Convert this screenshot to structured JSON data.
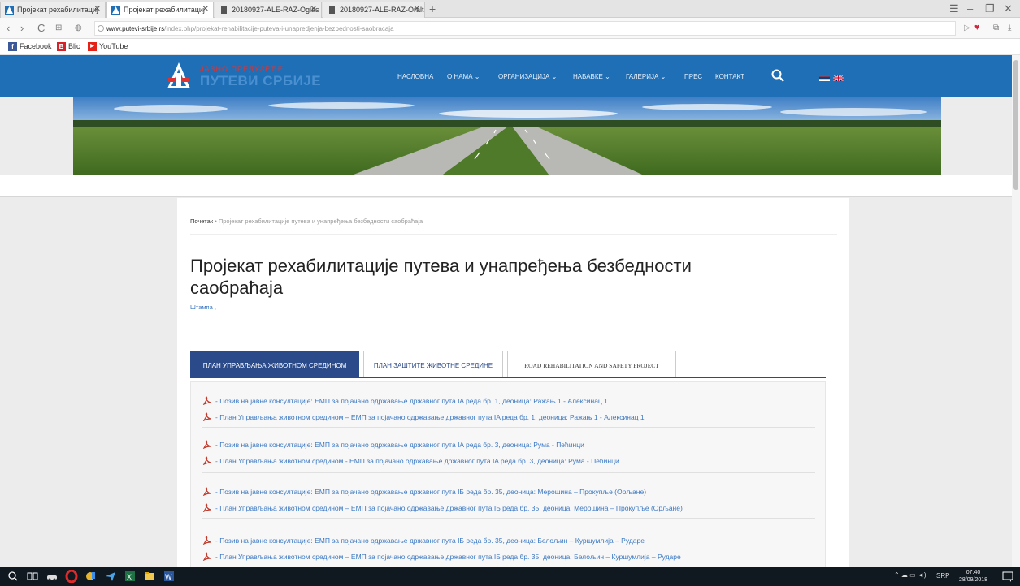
{
  "browser": {
    "tabs": [
      {
        "label": "Пројекат рехабилитациј",
        "active": false
      },
      {
        "label": "Пројекат рехабилитациј",
        "active": true
      },
      {
        "label": "20180927-ALE-RAZ-Oglas",
        "active": false
      },
      {
        "label": "20180927-ALE-RAZ-Oralt",
        "active": false
      }
    ],
    "new_tab": "+",
    "url_host": "www.putevi-srbije.rs",
    "url_path": "/index.php/projekat-rehabilitacije-puteva-i-unapredjenja-bezbednosti-saobracaja",
    "bookmarks": [
      {
        "label": "Facebook",
        "color": "#3b5998",
        "glyph": "f"
      },
      {
        "label": "Blic",
        "color": "#d6232a",
        "glyph": "B"
      },
      {
        "label": "YouTube",
        "color": "#e62117",
        "glyph": "▶"
      }
    ]
  },
  "site": {
    "logo_top": "ЈАВНО ПРЕДУЗЕЋЕ",
    "logo_main": "ПУТЕВИ СРБИЈЕ",
    "menu": [
      "НАСЛОВНА",
      "О НАМА",
      "ОРГАНИЗАЦИЈА",
      "НАБАВКЕ",
      "ГАЛЕРИЈА",
      "ПРЕС",
      "КОНТАКТ"
    ],
    "menu_has_dropdown": [
      false,
      true,
      true,
      true,
      true,
      false,
      false
    ],
    "header_color": "#1f6fb7"
  },
  "content": {
    "breadcrumb_home": "Почетак",
    "breadcrumb_sep": "•",
    "breadcrumb_current": "Пројекат рехабилитације путева и унапређења безбедности саобраћаја",
    "title": "Пројекат рехабилитације путева и унапређења безбедности саобраћаја",
    "print_link": "Штампа ,",
    "tabs": [
      {
        "label": "ПЛАН УПРАВЉАЊА ЖИВОТНОМ СРЕДИНОМ",
        "active": true
      },
      {
        "label": "ПЛАН ЗАШТИТЕ ЖИВОТНЕ СРЕДИНЕ",
        "active": false
      },
      {
        "label": "ROAD REHABILITATION AND SAFETY PROJECT",
        "active": false
      }
    ],
    "doc_groups": [
      [
        "- Позив на јавне консултације: ЕМП за појачано одржавање државног пута IA реда бр. 1, деоница: Ражањ 1 - Алексинац 1",
        "- План Управљања животном средином – ЕМП за појачано одржавање државног пута IA реда бр. 1, деоница: Ражањ 1 - Алексинац 1"
      ],
      [
        "- Позив на јавне консултације: ЕМП за појачано одржавање државног пута IA реда бр. 3, деоница: Рума - Пећинци",
        "- План Управљања животном средином - ЕМП за појачано одржавање државног пута IA реда бр. 3, деоница: Рума - Пећинци"
      ],
      [
        "- Позив на јавне консултације: ЕМП за појачано одржавање државног пута IБ реда бр. 35, деоница: Мерошина – Прокупље (Орљане)",
        "- План Управљања животном средином – ЕМП за појачано одржавање државног пута IБ реда бр. 35, деоница: Мерошина – Прокупље (Орљане)"
      ],
      [
        "- Позив на јавне консултације: ЕМП за појачано одржавање државног пута IБ реда бр. 35, деоница: Белољин – Куршумлија – Рударе",
        "- План Управљања животном средином – ЕМП за појачано одржавање државног пута IБ реда бр. 35, деоница: Белољин – Куршумлија – Рударе"
      ]
    ]
  },
  "taskbar": {
    "lang": "SRP",
    "time": "07:40",
    "date": "28/09/2018"
  }
}
